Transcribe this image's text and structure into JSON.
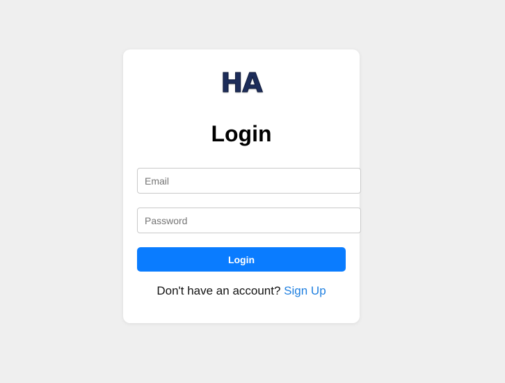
{
  "logo": {
    "text": "HA"
  },
  "login": {
    "title": "Login",
    "email_placeholder": "Email",
    "password_placeholder": "Password",
    "submit_label": "Login",
    "signup_prompt": "Don't have an account?",
    "signup_link": "Sign Up"
  },
  "colors": {
    "page_background": "#efefef",
    "card_background": "#ffffff",
    "primary_button": "#0a7cff",
    "link": "#1e7fe0",
    "logo": "#1d2d5a"
  }
}
